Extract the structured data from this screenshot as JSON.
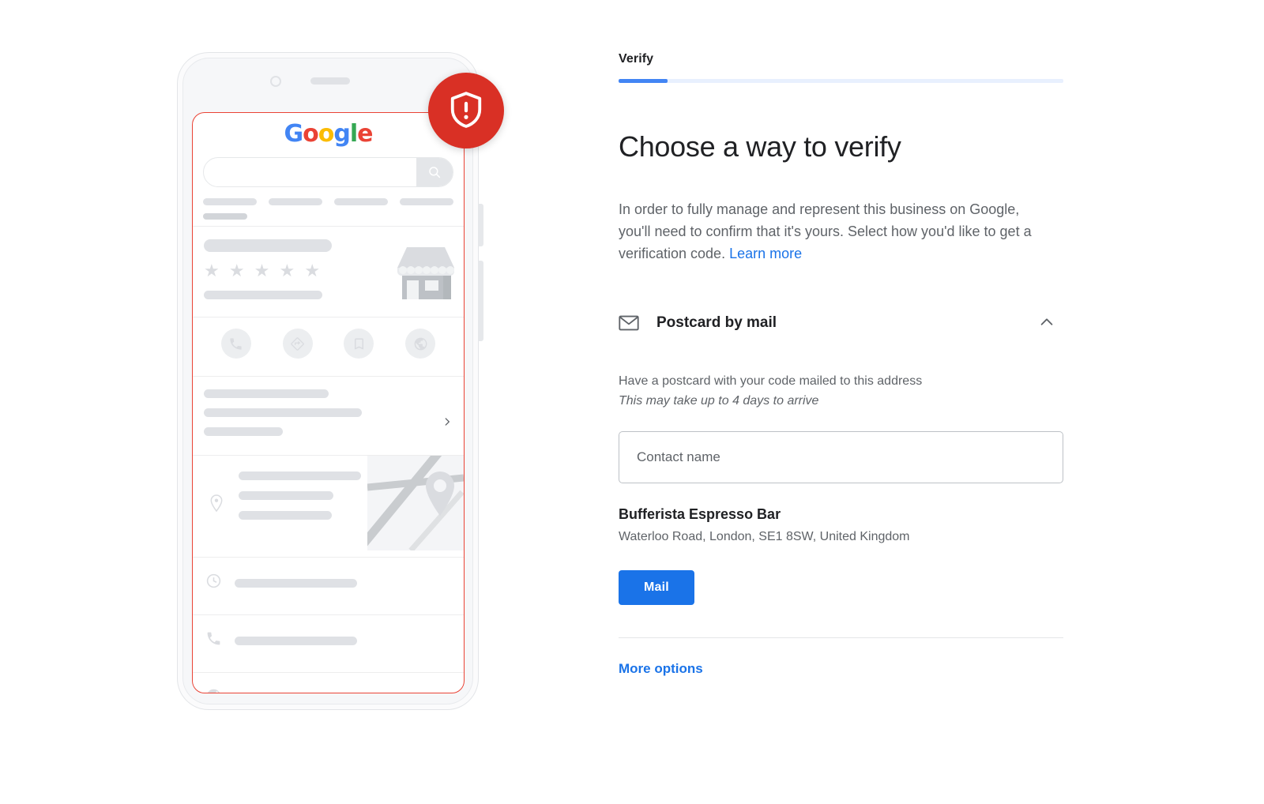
{
  "verify": {
    "tab_label": "Verify",
    "progress_percent": 11,
    "headline": "Choose a way to verify",
    "intro_text": "In order to fully manage and represent this business on Google, you'll need to confirm that it's yours. Select how you'd like to get a verification code.",
    "learn_more_label": "Learn more",
    "method": {
      "icon": "envelope-icon",
      "title": "Postcard by mail",
      "expanded": true,
      "chevron_icon": "chevron-up-icon",
      "description": "Have a postcard with your code mailed to this address",
      "note": "This may take up to 4 days to arrive",
      "contact_name_placeholder": "Contact name",
      "contact_name_value": "",
      "business_name": "Bufferista Espresso Bar",
      "business_address": "Waterloo Road, London, SE1 8SW, United Kingdom",
      "submit_label": "Mail"
    },
    "more_options_label": "More options"
  },
  "phone_mockup": {
    "google_logo_letters": [
      "G",
      "o",
      "o",
      "g",
      "l",
      "e"
    ],
    "badge_icon": "shield-alert-icon",
    "search_icon": "search-icon",
    "action_icons": [
      "call-icon",
      "directions-icon",
      "bookmark-icon",
      "website-icon"
    ],
    "detail_icons": [
      "location-pin-icon",
      "clock-icon",
      "phone-icon",
      "globe-icon"
    ],
    "chevron_icon": "chevron-right-icon",
    "star_rating_glyphs": "★ ★ ★ ★ ★",
    "storefront_icon": "storefront-icon",
    "map_icon": "map-thumbnail"
  },
  "colors": {
    "accent_blue": "#1a73e8",
    "progress_blue": "#4285f4",
    "progress_track": "#e8f0fe",
    "alert_red": "#d93025",
    "highlight_red": "#ea4335",
    "text_primary": "#202124",
    "text_secondary": "#5f6368",
    "placeholder_gray": "#dfe1e5"
  }
}
